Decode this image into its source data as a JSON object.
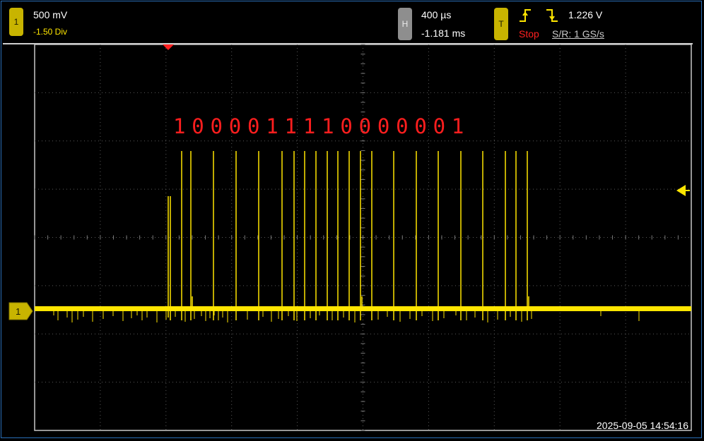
{
  "channel1": {
    "badge_label": "1",
    "scale": "500 mV",
    "offset": "-1.50 Div",
    "color": "#ffe600"
  },
  "horizontal": {
    "badge_label": "H",
    "timebase": "400 µs",
    "delay": "-1.181 ms"
  },
  "trigger": {
    "badge_label": "T",
    "level": "1.226 V",
    "state": "Stop",
    "sample_rate": "S/R: 1 GS/s",
    "edge_icons": [
      "rising-edge-icon",
      "falling-edge-icon"
    ]
  },
  "annotation": {
    "bits": "1000011110000001",
    "color": "#ff1e1e"
  },
  "timestamp": "2025-09-05 14:54:16",
  "markers": {
    "trigger_position": "trigger-position-marker",
    "trigger_level": "trigger-level-marker",
    "channel_ground": "1"
  }
}
